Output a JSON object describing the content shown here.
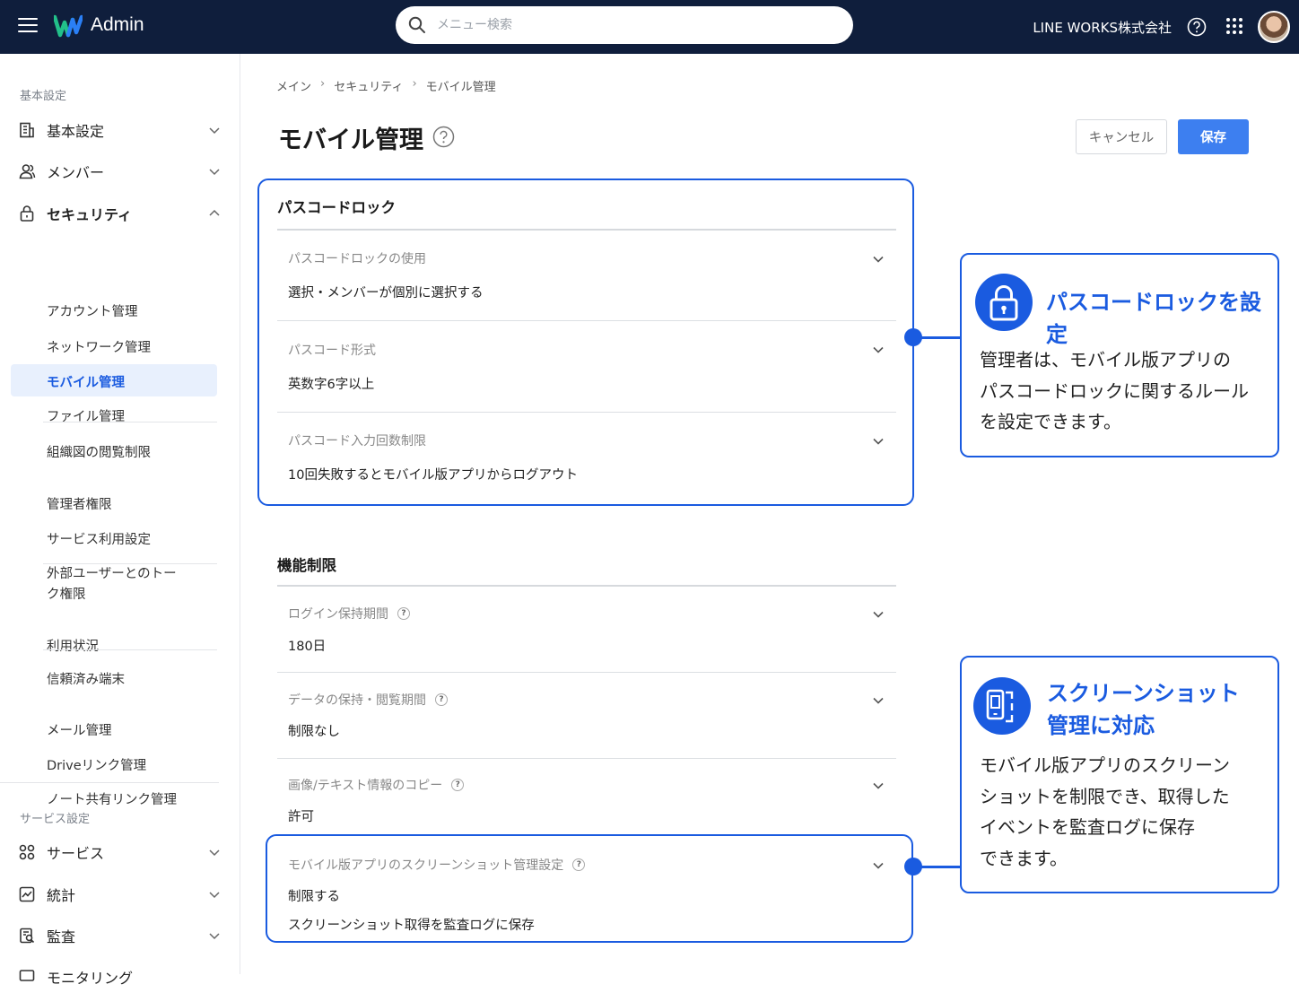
{
  "header": {
    "app_title": "Admin",
    "search_placeholder": "メニュー検索",
    "company": "LINE WORKS株式会社",
    "icons": [
      "menu-icon",
      "line-works-logo",
      "search-icon",
      "help-icon",
      "apps-grid-icon",
      "avatar"
    ]
  },
  "sidebar": {
    "section_basic": "基本設定",
    "items": {
      "basic": "基本設定",
      "member": "メンバー",
      "security": "セキュリティ",
      "service": "サービス",
      "stats": "統計",
      "audit": "監査",
      "monitoring": "モニタリング"
    },
    "security_sub": [
      "アカウント管理",
      "ネットワーク管理",
      "モバイル管理",
      "ファイル管理",
      "組織図の閲覧制限",
      "管理者権限",
      "サービス利用設定",
      "外部ユーザーとのトー",
      "ク権限",
      "利用状況",
      "信頼済み端末",
      "メール管理",
      "Driveリンク管理",
      "ノート共有リンク管理"
    ],
    "section_service": "サービス設定"
  },
  "breadcrumb": [
    "メイン",
    "セキュリティ",
    "モバイル管理"
  ],
  "breadcrumb_sep": "›",
  "page": {
    "title": "モバイル管理",
    "cancel": "キャンセル",
    "save": "保存"
  },
  "passcode": {
    "heading": "パスコードロック",
    "rows": [
      {
        "label": "パスコードロックの使用",
        "value": "選択・メンバーが個別に選択する"
      },
      {
        "label": "パスコード形式",
        "value": "英数字6字以上"
      },
      {
        "label": "パスコード入力回数制限",
        "value": "10回失敗するとモバイル版アプリからログアウト"
      }
    ]
  },
  "features": {
    "heading": "機能制限",
    "help_mark": "?",
    "rows": [
      {
        "label": "ログイン保持期間",
        "value": "180日"
      },
      {
        "label": "データの保持・閲覧期間",
        "value": "制限なし"
      },
      {
        "label": "画像/テキスト情報のコピー",
        "value": "許可"
      },
      {
        "label": "モバイル版アプリのスクリーンショット管理設定",
        "value": "制限する",
        "value2": "スクリーンショット取得を監査ログに保存"
      }
    ]
  },
  "callouts": {
    "passcode": {
      "title": "パスコードロックを設定",
      "body": [
        "管理者は、モバイル版アプリの",
        "パスコードロックに関するルール",
        "を設定できます。"
      ]
    },
    "screenshot": {
      "title": [
        "スクリーンショット",
        "管理に対応"
      ],
      "body": [
        "モバイル版アプリのスクリーン",
        "ショットを制限でき、取得した",
        "イベントを監査ログに保存",
        "できます。"
      ]
    }
  },
  "colors": {
    "header_bg": "#0f1e3c",
    "accent": "#1a5be0",
    "save_button": "#3d7ff0",
    "active_nav_bg": "#e8f0fd"
  }
}
